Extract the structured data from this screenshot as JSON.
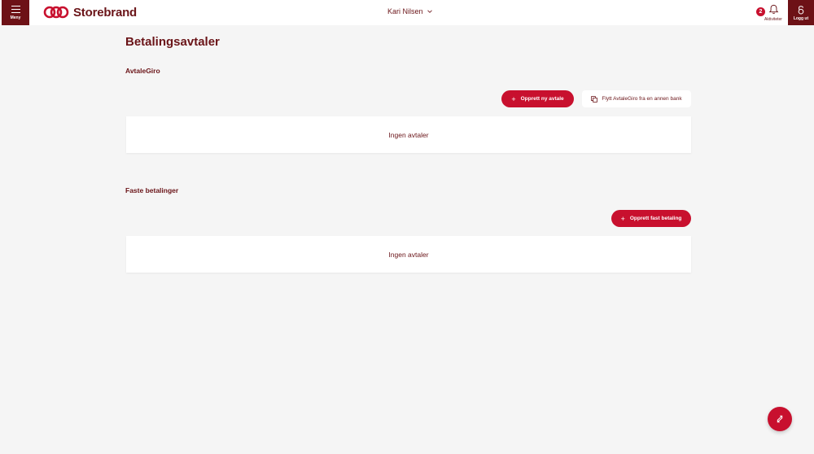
{
  "header": {
    "menu_label": "Meny",
    "brand_name": "Storebrand",
    "user_name": "Kari Nilsen",
    "activities_count": "2",
    "activities_label": "Aktiviteter",
    "logout_label": "Logg ut"
  },
  "main": {
    "title": "Betalingsavtaler",
    "avtalegiro": {
      "title": "AvtaleGiro",
      "create_label": "Opprett ny avtale",
      "move_label": "Flytt AvtaleGiro fra en annen bank",
      "empty_text": "Ingen avtaler"
    },
    "faste": {
      "title": "Faste betalinger",
      "create_label": "Opprett fast betaling",
      "empty_text": "Ingen avtaler"
    }
  },
  "colors": {
    "brand_dark": "#6d1116",
    "brand_red": "#c8102e",
    "text": "#6a1418",
    "background": "#f5f5f5"
  },
  "icons": {
    "menu": "hamburger-icon",
    "logo": "storebrand-logo-icon",
    "chevron": "chevron-down-icon",
    "bell": "bell-icon",
    "logout": "lock-icon",
    "plus": "plus-icon",
    "copy": "copy-icon",
    "fab": "swap-arrows-icon"
  }
}
